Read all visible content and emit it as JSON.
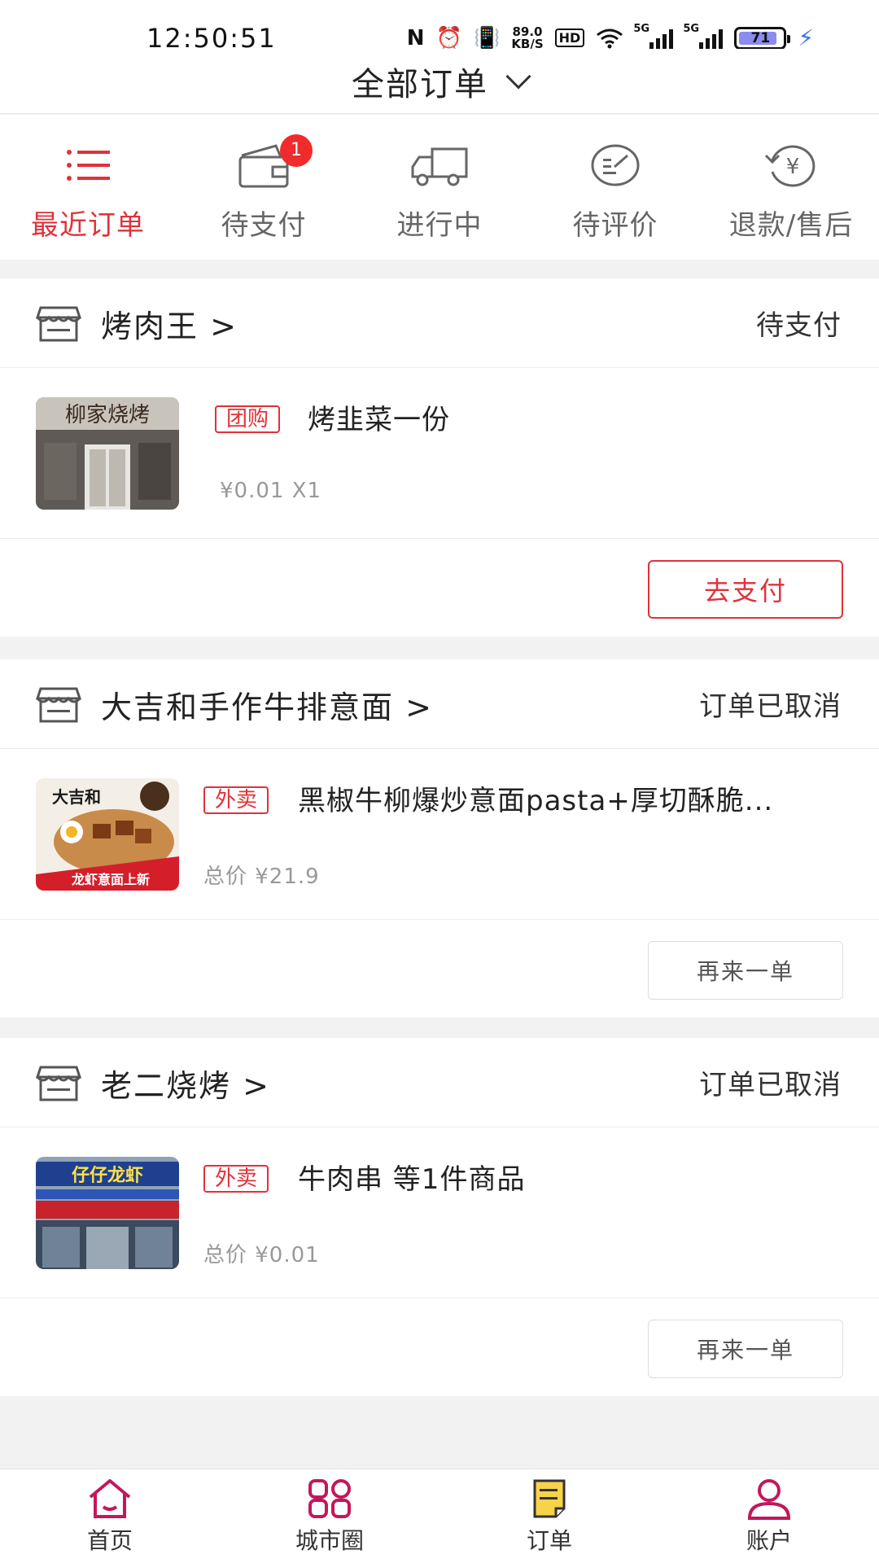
{
  "status_bar": {
    "time": "12:50:51",
    "net_speed": "89.0",
    "net_unit": "KB/S",
    "hd": "HD",
    "sig1": "5G",
    "sig2": "5G",
    "battery": "71"
  },
  "header": {
    "title": "全部订单"
  },
  "tabs": [
    {
      "label": "最近订单",
      "icon": "list-icon",
      "active": true
    },
    {
      "label": "待支付",
      "icon": "wallet-icon",
      "badge": "1"
    },
    {
      "label": "进行中",
      "icon": "truck-icon"
    },
    {
      "label": "待评价",
      "icon": "review-icon"
    },
    {
      "label": "退款/售后",
      "icon": "refund-icon"
    }
  ],
  "orders": [
    {
      "store": "烤肉王 >",
      "status": "待支付",
      "tag": "团购",
      "item": "烤韭菜一份",
      "price": "¥0.01 X1",
      "button": "去支付",
      "thumb_sign": "柳家烧烤"
    },
    {
      "store": "大吉和手作牛排意面 >",
      "status": "订单已取消",
      "tag": "外卖",
      "item": "黑椒牛柳爆炒意面pasta+厚切酥脆...",
      "price": "总价 ¥21.9",
      "button": "再来一单",
      "thumb_sign": "大吉和",
      "thumb_banner": "龙虾意面上新"
    },
    {
      "store": "老二烧烤 >",
      "status": "订单已取消",
      "tag": "外卖",
      "item": "牛肉串 等1件商品",
      "price": "总价 ¥0.01",
      "button": "再来一单",
      "thumb_sign": "仔仔龙虾"
    }
  ],
  "bottom_nav": [
    {
      "label": "首页",
      "icon": "home-icon"
    },
    {
      "label": "城市圈",
      "icon": "city-circle-icon"
    },
    {
      "label": "订单",
      "icon": "order-icon"
    },
    {
      "label": "账户",
      "icon": "account-icon"
    }
  ],
  "colors": {
    "accent": "#e0323a",
    "nav_pink": "#c2185b",
    "badge": "#f02b2b"
  }
}
